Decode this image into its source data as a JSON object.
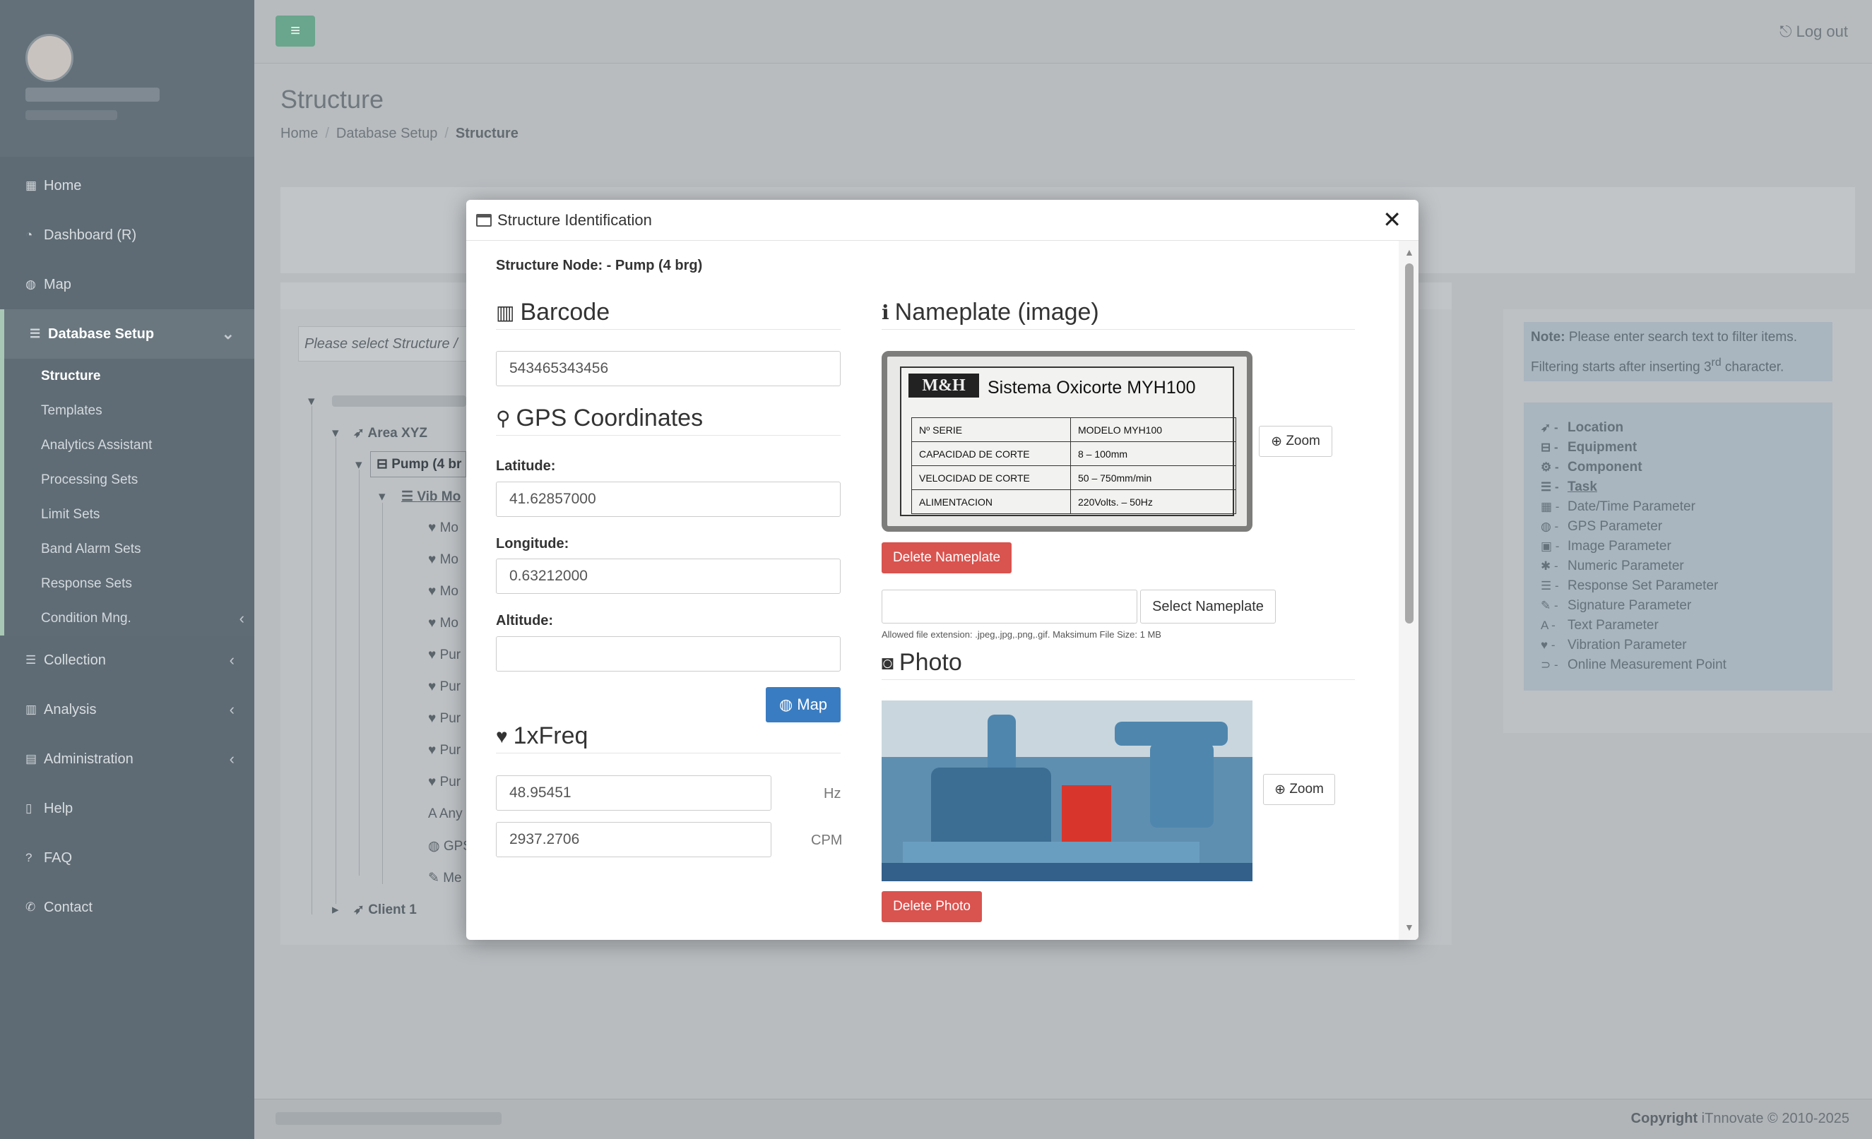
{
  "sidebar": {
    "nav": [
      {
        "label": "Home",
        "icon": "th-large-icon"
      },
      {
        "label": "Dashboard (R)",
        "icon": "pie-chart-icon"
      },
      {
        "label": "Map",
        "icon": "globe-icon"
      },
      {
        "label": "Database Setup",
        "icon": "database-icon"
      }
    ],
    "database_setup_items": [
      "Structure",
      "Templates",
      "Analytics Assistant",
      "Processing Sets",
      "Limit Sets",
      "Band Alarm Sets",
      "Response Sets",
      "Condition Mng."
    ],
    "nav_bottom": [
      {
        "label": "Collection",
        "icon": "list-icon"
      },
      {
        "label": "Analysis",
        "icon": "bar-chart-icon"
      },
      {
        "label": "Administration",
        "icon": "archive-icon"
      },
      {
        "label": "Help",
        "icon": "book-icon"
      },
      {
        "label": "FAQ",
        "icon": "question-icon"
      },
      {
        "label": "Contact",
        "icon": "phone-icon"
      }
    ]
  },
  "topbar": {
    "logout_label": "Log out"
  },
  "page": {
    "title": "Structure",
    "breadcrumb": [
      "Home",
      "Database Setup",
      "Structure"
    ]
  },
  "tree": {
    "hint": "Please select Structure /",
    "nodes": {
      "area": "Area XYZ",
      "pump": "Pump (4 br",
      "vib": "Vib Mo",
      "children": [
        "Mo",
        "Mo",
        "Mo",
        "Mo",
        "Pur",
        "Pur",
        "Pur",
        "Pur",
        "Pur",
        "Any",
        "GPS",
        "Me"
      ],
      "client": "Client 1"
    }
  },
  "note": {
    "label": "Note:",
    "text1": " Please enter search text to filter items.",
    "text2": "Filtering starts after inserting 3",
    "sup": "rd",
    "text3": " character."
  },
  "legend": [
    {
      "label": "Location",
      "icon": "location-arrow-icon",
      "bold": true
    },
    {
      "label": "Equipment",
      "icon": "hdd-icon",
      "bold": true
    },
    {
      "label": "Component",
      "icon": "cog-icon",
      "bold": true
    },
    {
      "label": "Task",
      "icon": "bars-icon",
      "bold": true,
      "underline": true
    },
    {
      "label": "Date/Time Parameter",
      "icon": "calendar-icon"
    },
    {
      "label": "GPS Parameter",
      "icon": "globe-icon"
    },
    {
      "label": "Image Parameter",
      "icon": "image-icon"
    },
    {
      "label": "Numeric Parameter",
      "icon": "asterisk-icon"
    },
    {
      "label": "Response Set Parameter",
      "icon": "list-icon"
    },
    {
      "label": "Signature Parameter",
      "icon": "edit-icon"
    },
    {
      "label": "Text Parameter",
      "icon": "font-icon"
    },
    {
      "label": "Vibration Parameter",
      "icon": "heartbeat-icon"
    },
    {
      "label": "Online Measurement Point",
      "icon": "rss-icon"
    }
  ],
  "footer": {
    "copyright_label": "Copyright",
    "copyright_text": " iTnnovate © 2010-2025"
  },
  "modal": {
    "title": "Structure Identification",
    "node_label": "Structure Node:",
    "node_value": " - Pump (4 brg)",
    "barcode": {
      "title": "Barcode",
      "value": "543465343456"
    },
    "gps": {
      "title": "GPS Coordinates",
      "latitude_label": "Latitude:",
      "latitude": "41.62857000",
      "longitude_label": "Longitude:",
      "longitude": "0.63212000",
      "altitude_label": "Altitude:",
      "altitude": "",
      "map_button": "Map"
    },
    "freq": {
      "title": "1xFreq",
      "hz_value": "48.95451",
      "hz_unit": "Hz",
      "cpm_value": "2937.2706",
      "cpm_unit": "CPM"
    },
    "nameplate": {
      "title": "Nameplate (image)",
      "zoom": "Zoom",
      "delete": "Delete Nameplate",
      "select": "Select Nameplate",
      "help": "Allowed file extension: .jpeg,.jpg,.png,.gif. Maksimum File Size: 1 MB",
      "plate": {
        "logo": "M&H",
        "title": "Sistema  Oxicorte  MYH100",
        "rows": [
          [
            "Nº  SERIE",
            "MODELO       MYH100"
          ],
          [
            "CAPACIDAD  DE  CORTE",
            "8 – 100mm"
          ],
          [
            "VELOCIDAD  DE  CORTE",
            "50 – 750mm/min"
          ],
          [
            "ALIMENTACION",
            "220Volts. – 50Hz"
          ]
        ]
      }
    },
    "photo": {
      "title": "Photo",
      "zoom": "Zoom",
      "delete": "Delete Photo"
    }
  }
}
